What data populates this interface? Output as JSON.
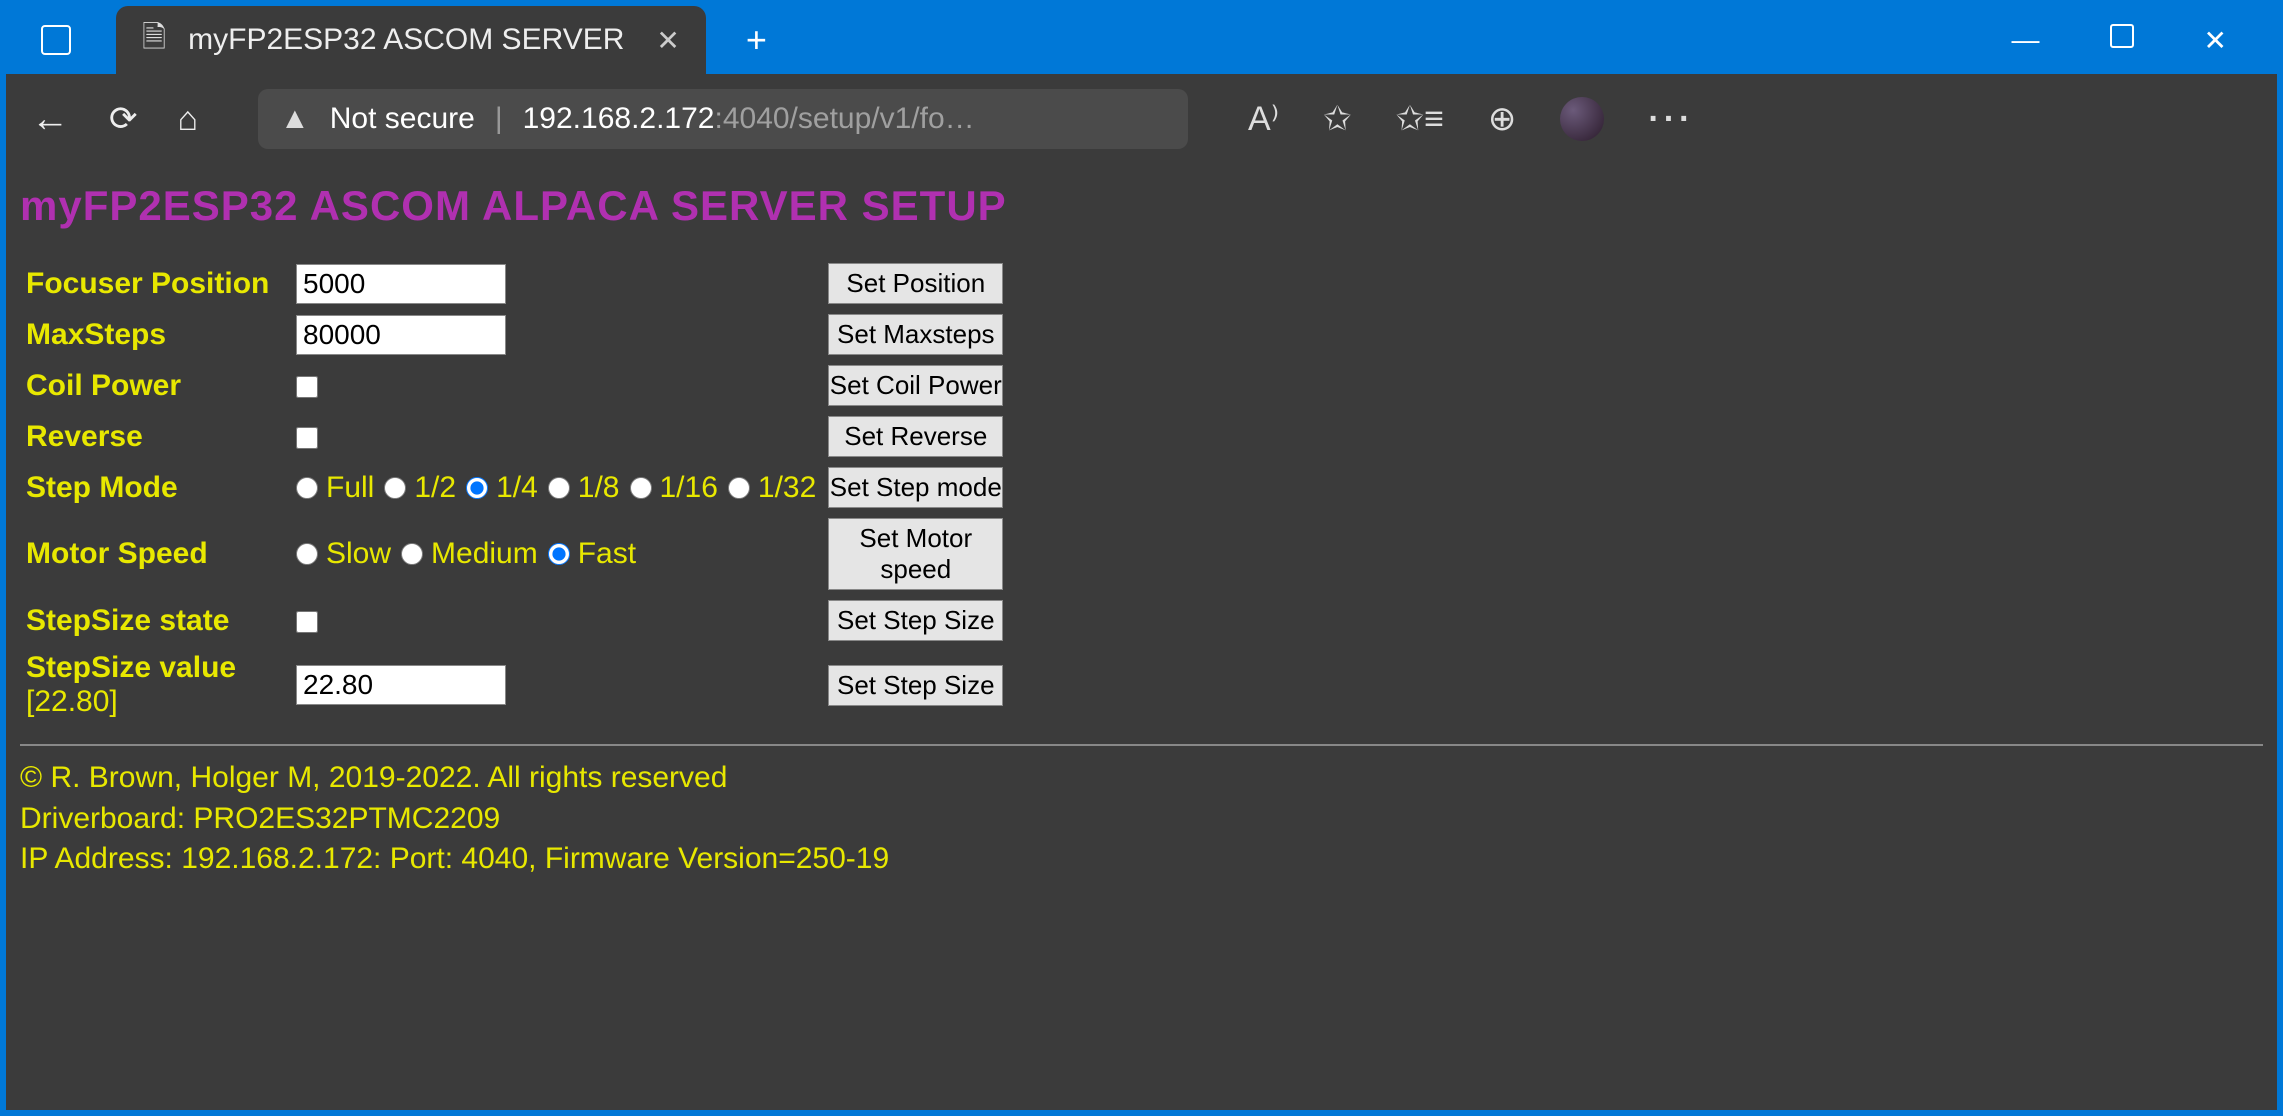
{
  "window": {
    "tab_title": "myFP2ESP32 ASCOM SERVER",
    "address_not_secure": "Not secure",
    "address_host": "192.168.2.172",
    "address_port_path": ":4040/setup/v1/fo…"
  },
  "page": {
    "title": "myFP2ESP32 ASCOM ALPACA SERVER SETUP"
  },
  "form": {
    "focuser_position": {
      "label": "Focuser Position",
      "value": "5000",
      "button": "Set Position"
    },
    "max_steps": {
      "label": "MaxSteps",
      "value": "80000",
      "button": "Set Maxsteps"
    },
    "coil_power": {
      "label": "Coil Power",
      "checked": false,
      "button": "Set Coil Power"
    },
    "reverse": {
      "label": "Reverse",
      "checked": false,
      "button": "Set Reverse"
    },
    "step_mode": {
      "label": "Step Mode",
      "options": [
        "Full",
        "1/2",
        "1/4",
        "1/8",
        "1/16",
        "1/32"
      ],
      "selected": "1/4",
      "button": "Set Step mode"
    },
    "motor_speed": {
      "label": "Motor Speed",
      "options": [
        "Slow",
        "Medium",
        "Fast"
      ],
      "selected": "Fast",
      "button": "Set Motor speed"
    },
    "stepsize_state": {
      "label": "StepSize state",
      "checked": false,
      "button": "Set Step Size"
    },
    "stepsize_value": {
      "label": "StepSize value",
      "suffix": "[22.80]",
      "value": "22.80",
      "button": "Set Step Size"
    }
  },
  "footer": {
    "copyright": "© R. Brown, Holger M, 2019-2022. All rights reserved",
    "driverboard": "Driverboard: PRO2ES32PTMC2209",
    "ipinfo": "IP Address: 192.168.2.172: Port: 4040, Firmware Version=250-19"
  }
}
